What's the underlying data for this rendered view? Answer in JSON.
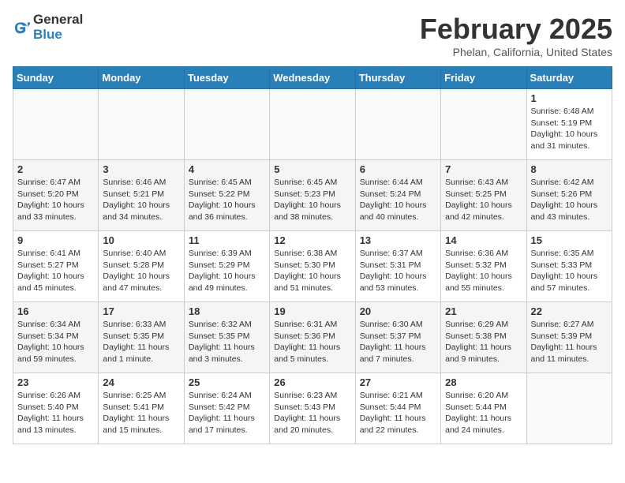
{
  "header": {
    "logo_general": "General",
    "logo_blue": "Blue",
    "month_title": "February 2025",
    "location": "Phelan, California, United States"
  },
  "days_of_week": [
    "Sunday",
    "Monday",
    "Tuesday",
    "Wednesday",
    "Thursday",
    "Friday",
    "Saturday"
  ],
  "weeks": [
    [
      {
        "day": "",
        "info": ""
      },
      {
        "day": "",
        "info": ""
      },
      {
        "day": "",
        "info": ""
      },
      {
        "day": "",
        "info": ""
      },
      {
        "day": "",
        "info": ""
      },
      {
        "day": "",
        "info": ""
      },
      {
        "day": "1",
        "info": "Sunrise: 6:48 AM\nSunset: 5:19 PM\nDaylight: 10 hours and 31 minutes."
      }
    ],
    [
      {
        "day": "2",
        "info": "Sunrise: 6:47 AM\nSunset: 5:20 PM\nDaylight: 10 hours and 33 minutes."
      },
      {
        "day": "3",
        "info": "Sunrise: 6:46 AM\nSunset: 5:21 PM\nDaylight: 10 hours and 34 minutes."
      },
      {
        "day": "4",
        "info": "Sunrise: 6:45 AM\nSunset: 5:22 PM\nDaylight: 10 hours and 36 minutes."
      },
      {
        "day": "5",
        "info": "Sunrise: 6:45 AM\nSunset: 5:23 PM\nDaylight: 10 hours and 38 minutes."
      },
      {
        "day": "6",
        "info": "Sunrise: 6:44 AM\nSunset: 5:24 PM\nDaylight: 10 hours and 40 minutes."
      },
      {
        "day": "7",
        "info": "Sunrise: 6:43 AM\nSunset: 5:25 PM\nDaylight: 10 hours and 42 minutes."
      },
      {
        "day": "8",
        "info": "Sunrise: 6:42 AM\nSunset: 5:26 PM\nDaylight: 10 hours and 43 minutes."
      }
    ],
    [
      {
        "day": "9",
        "info": "Sunrise: 6:41 AM\nSunset: 5:27 PM\nDaylight: 10 hours and 45 minutes."
      },
      {
        "day": "10",
        "info": "Sunrise: 6:40 AM\nSunset: 5:28 PM\nDaylight: 10 hours and 47 minutes."
      },
      {
        "day": "11",
        "info": "Sunrise: 6:39 AM\nSunset: 5:29 PM\nDaylight: 10 hours and 49 minutes."
      },
      {
        "day": "12",
        "info": "Sunrise: 6:38 AM\nSunset: 5:30 PM\nDaylight: 10 hours and 51 minutes."
      },
      {
        "day": "13",
        "info": "Sunrise: 6:37 AM\nSunset: 5:31 PM\nDaylight: 10 hours and 53 minutes."
      },
      {
        "day": "14",
        "info": "Sunrise: 6:36 AM\nSunset: 5:32 PM\nDaylight: 10 hours and 55 minutes."
      },
      {
        "day": "15",
        "info": "Sunrise: 6:35 AM\nSunset: 5:33 PM\nDaylight: 10 hours and 57 minutes."
      }
    ],
    [
      {
        "day": "16",
        "info": "Sunrise: 6:34 AM\nSunset: 5:34 PM\nDaylight: 10 hours and 59 minutes."
      },
      {
        "day": "17",
        "info": "Sunrise: 6:33 AM\nSunset: 5:35 PM\nDaylight: 11 hours and 1 minute."
      },
      {
        "day": "18",
        "info": "Sunrise: 6:32 AM\nSunset: 5:35 PM\nDaylight: 11 hours and 3 minutes."
      },
      {
        "day": "19",
        "info": "Sunrise: 6:31 AM\nSunset: 5:36 PM\nDaylight: 11 hours and 5 minutes."
      },
      {
        "day": "20",
        "info": "Sunrise: 6:30 AM\nSunset: 5:37 PM\nDaylight: 11 hours and 7 minutes."
      },
      {
        "day": "21",
        "info": "Sunrise: 6:29 AM\nSunset: 5:38 PM\nDaylight: 11 hours and 9 minutes."
      },
      {
        "day": "22",
        "info": "Sunrise: 6:27 AM\nSunset: 5:39 PM\nDaylight: 11 hours and 11 minutes."
      }
    ],
    [
      {
        "day": "23",
        "info": "Sunrise: 6:26 AM\nSunset: 5:40 PM\nDaylight: 11 hours and 13 minutes."
      },
      {
        "day": "24",
        "info": "Sunrise: 6:25 AM\nSunset: 5:41 PM\nDaylight: 11 hours and 15 minutes."
      },
      {
        "day": "25",
        "info": "Sunrise: 6:24 AM\nSunset: 5:42 PM\nDaylight: 11 hours and 17 minutes."
      },
      {
        "day": "26",
        "info": "Sunrise: 6:23 AM\nSunset: 5:43 PM\nDaylight: 11 hours and 20 minutes."
      },
      {
        "day": "27",
        "info": "Sunrise: 6:21 AM\nSunset: 5:44 PM\nDaylight: 11 hours and 22 minutes."
      },
      {
        "day": "28",
        "info": "Sunrise: 6:20 AM\nSunset: 5:44 PM\nDaylight: 11 hours and 24 minutes."
      },
      {
        "day": "",
        "info": ""
      }
    ]
  ]
}
